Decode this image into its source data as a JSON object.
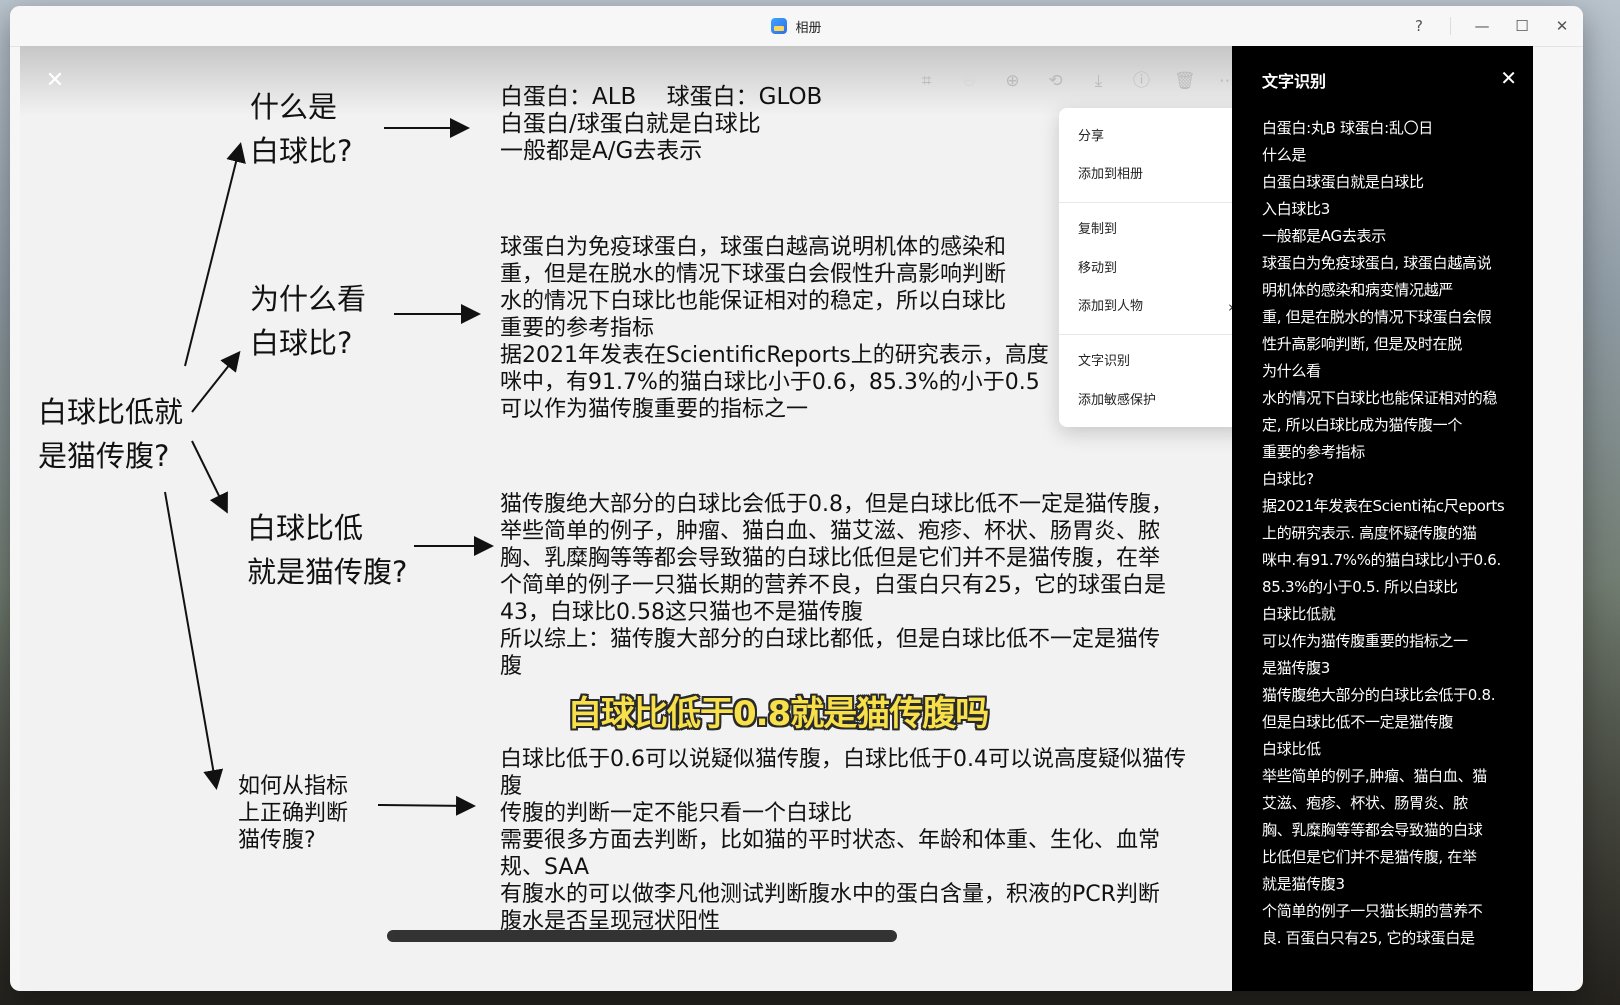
{
  "window": {
    "title": "相册"
  },
  "window_controls": {
    "help": "?",
    "minimize": "—",
    "maximize": "☐",
    "close": "✕"
  },
  "viewer": {
    "close": "✕",
    "toolbar": [
      "scan-icon",
      "zoom-out-icon",
      "zoom-in-icon",
      "rotate-icon",
      "download-icon",
      "info-icon",
      "delete-icon",
      "more-icon"
    ]
  },
  "note": {
    "root": [
      "白球比低就",
      "是猫传腹?"
    ],
    "q1": [
      "什么是",
      "白球比?"
    ],
    "q2": [
      "为什么看",
      "白球比?"
    ],
    "q3": [
      "白球比低",
      "就是猫传腹?"
    ],
    "q4": [
      "如何从指标",
      "上正确判断",
      "猫传腹?"
    ],
    "a1": "白蛋白：ALB　 球蛋白：GLOB\n白蛋白/球蛋白就是白球比\n一般都是A/G去表示",
    "a2": "球蛋白为免疫球蛋白，球蛋白越高说明机体的感染和\n重，但是在脱水的情况下球蛋白会假性升高影响判断\n水的情况下白球比也能保证相对的稳定，所以白球比\n重要的参考指标\n据2021年发表在ScientificReports上的研究表示，高度\n咪中，有91.7%的猫白球比小于0.6，85.3%的小于0.5\n可以作为猫传腹重要的指标之一",
    "a3": "猫传腹绝大部分的白球比会低于0.8，但是白球比低不一定是猫传腹，\n举些简单的例子，肿瘤、猫白血、猫艾滋、疱疹、杯状、肠胃炎、脓\n胸、乳糜胸等等都会导致猫的白球比低但是它们并不是猫传腹，在举\n个简单的例子一只猫长期的营养不良，白蛋白只有25，它的球蛋白是\n43，白球比0.58这只猫也不是猫传腹\n所以综上：猫传腹大部分的白球比都低，但是白球比低不一定是猫传\n腹",
    "a4": "白球比低于0.6可以说疑似猫传腹，白球比低于0.4可以说高度疑似猫传\n腹\n传腹的判断一定不能只看一个白球比\n需要很多方面去判断，比如猫的平时状态、年龄和体重、生化、血常\n规、SAA\n有腹水的可以做李凡他测试判断腹水中的蛋白含量，积液的PCR判断\n腹水是否呈现冠状阳性",
    "subtitle": "白球比低于0.8就是猫传腹吗"
  },
  "context_menu": {
    "share": "分享",
    "add_to_album": "添加到相册",
    "copy_to": "复制到",
    "move_to": "移动到",
    "add_to_person": "添加到人物",
    "ocr": "文字识别",
    "sensitive": "添加敏感保护"
  },
  "ocr_panel": {
    "title": "文字识别",
    "close": "✕",
    "lines": [
      "白蛋白:丸B 球蛋白:乱〇日",
      "什么是",
      "白蛋白球蛋白就是白球比",
      "入白球比3",
      "一般都是AG去表示",
      "球蛋白为免疫球蛋白, 球蛋白越高说",
      "明机体的感染和病变情况越严",
      "重, 但是在脱水的情况下球蛋白会假",
      "性升高影响判断, 但是及时在脱",
      "为什么看",
      "水的情况下白球比也能保证相对的稳",
      "定, 所以白球比成为猫传腹一个",
      "重要的参考指标",
      "白球比?",
      "据2021年发表在Scienti祐c尺eports",
      "上的研究表示. 高度怀疑传腹的猫",
      "咪中.有91.7%%的猫白球比小于0.6.",
      "85.3%的小于0.5. 所以白球比",
      "白球比低就",
      "可以作为猫传腹重要的指标之一",
      "是猫传腹3",
      "猫传腹绝大部分的白球比会低于0.8.",
      "但是白球比低不一定是猫传腹",
      "白球比低",
      "举些简单的例子,肿瘤、猫白血、猫",
      "艾滋、疱疹、杯状、肠胃炎、脓",
      "胸、乳糜胸等等都会导致猫的白球",
      "比低但是它们并不是猫传腹, 在举",
      "就是猫传腹3",
      "个简单的例子一只猫长期的营养不",
      "良. 百蛋白只有25, 它的球蛋白是"
    ]
  }
}
